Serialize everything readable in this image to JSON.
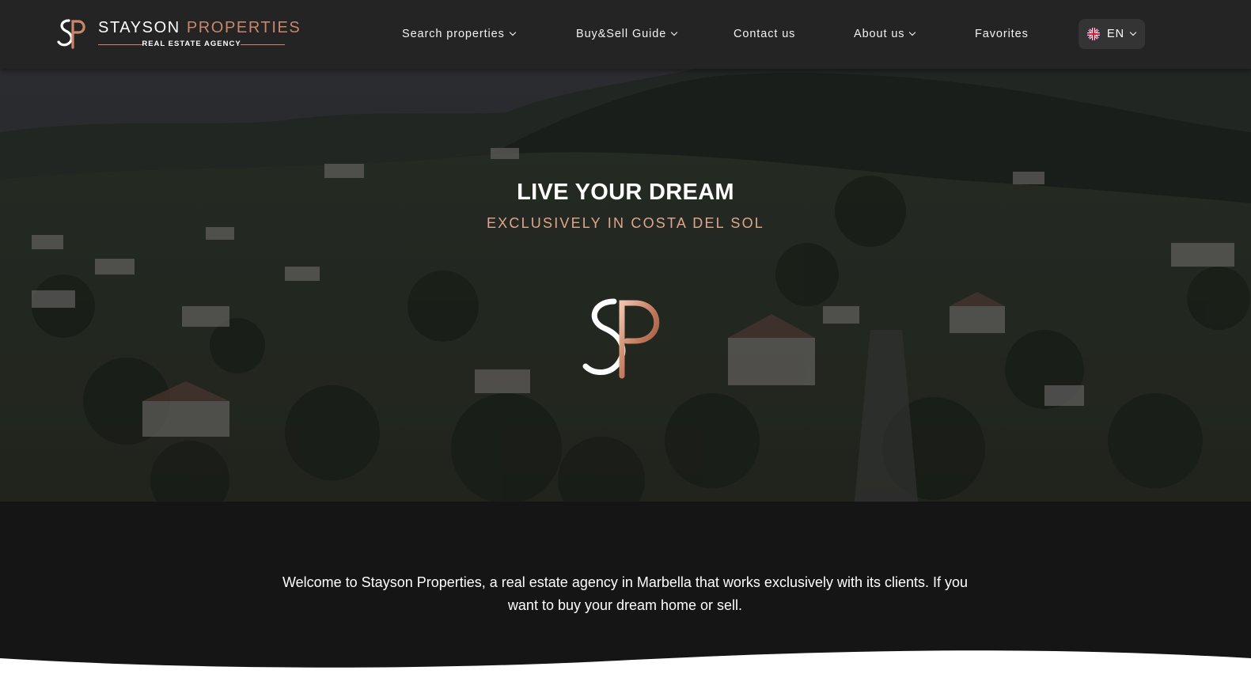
{
  "brand": {
    "name_part1": "STAYSON",
    "name_part2": "PROPERTIES",
    "tagline": "REAL ESTATE AGENCY",
    "monogram": "SP",
    "accent_color": "#c9866b"
  },
  "nav": {
    "items": [
      {
        "label": "Search properties",
        "has_dropdown": true
      },
      {
        "label": "Buy&Sell Guide",
        "has_dropdown": true
      },
      {
        "label": "Contact us",
        "has_dropdown": false
      },
      {
        "label": "About us",
        "has_dropdown": true
      },
      {
        "label": "Favorites",
        "has_dropdown": false
      }
    ],
    "language": {
      "code": "EN",
      "flag_icon": "uk-flag-icon"
    }
  },
  "hero": {
    "title": "LIVE YOUR DREAM",
    "subtitle": "EXCLUSIVELY IN COSTA DEL SOL",
    "background": "aerial view of hillside villas among trees"
  },
  "intro": {
    "text": "Welcome to Stayson Properties, a real estate agency in Marbella that works exclusively with its clients. If you want to buy your dream home or sell."
  },
  "colors": {
    "header_bg": "#242425",
    "page_bg": "#151516",
    "subtitle_color": "#e0a58a"
  }
}
